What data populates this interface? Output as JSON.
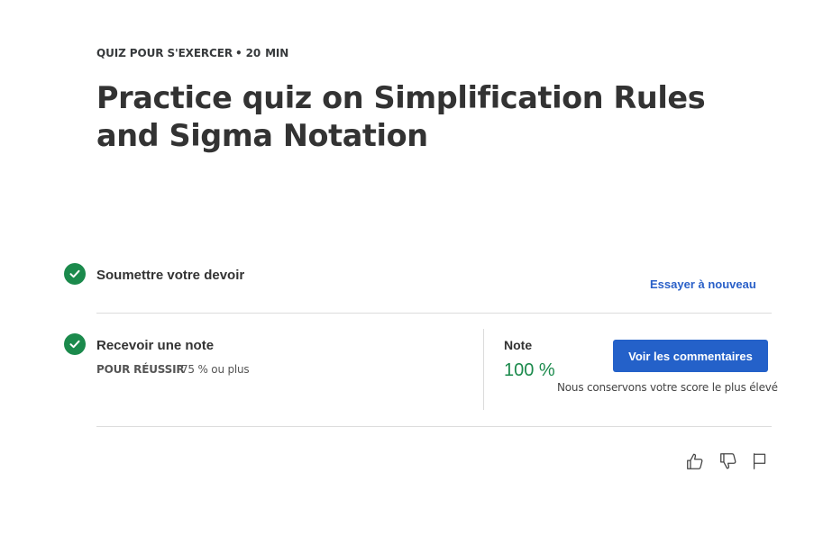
{
  "header": {
    "kicker_type": "QUIZ POUR S'EXERCER",
    "kicker_separator": "•",
    "kicker_duration": "20",
    "kicker_unit": "MIN",
    "title": "Practice quiz on Simplification Rules and Sigma Notation"
  },
  "steps": {
    "submit": {
      "label": "Soumettre votre devoir",
      "action_label": "Essayer à nouveau",
      "status_icon": "check-circle-icon"
    },
    "grade": {
      "label": "Recevoir une note",
      "pass_label": "POUR RÉUSSIR",
      "pass_value": "75 % ou plus",
      "status_icon": "check-circle-icon",
      "grade_label": "Note",
      "grade_value": "100 %",
      "feedback_button": "Voir les commentaires",
      "keep_note": "Nous conservons votre score le plus élevé"
    }
  },
  "feedback_icons": [
    "thumbs-up-icon",
    "thumbs-down-icon",
    "flag-icon"
  ],
  "colors": {
    "success": "#1b8a4c",
    "primary": "#2461c9",
    "link": "#2a60c8"
  }
}
